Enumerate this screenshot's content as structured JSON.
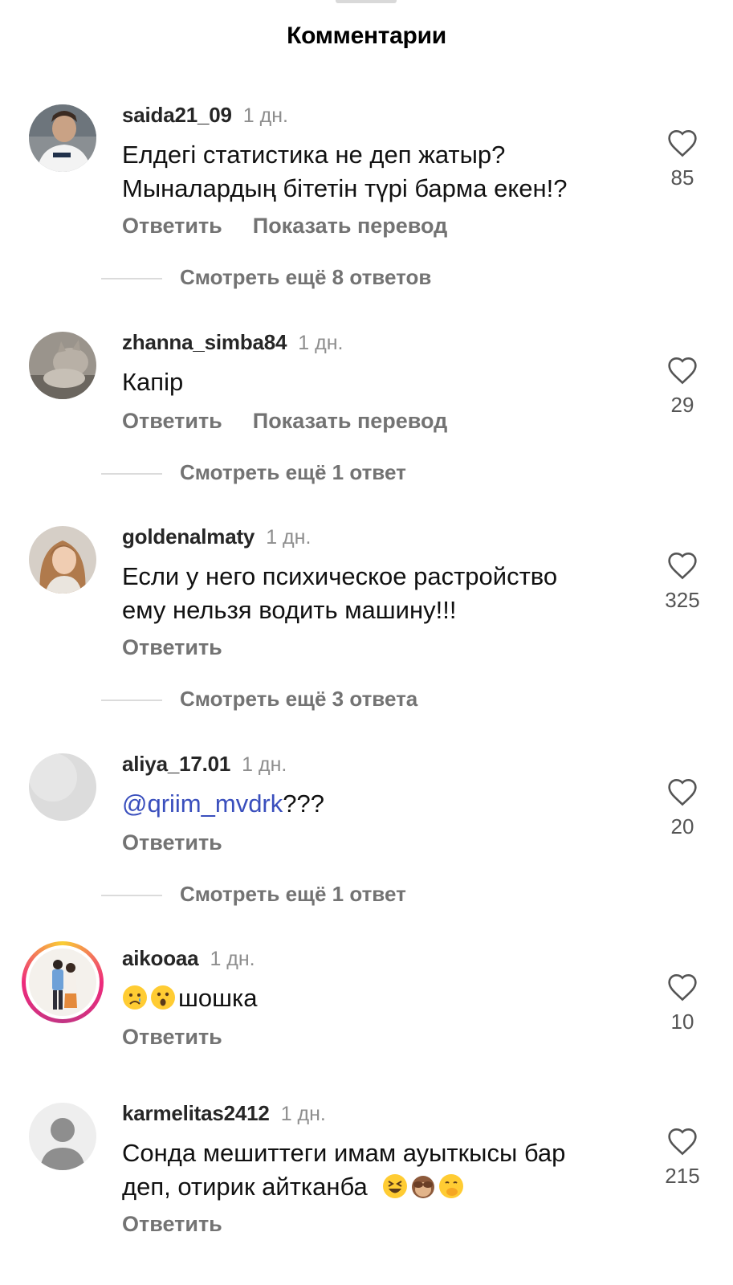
{
  "header": {
    "title": "Комментарии"
  },
  "comments": [
    {
      "username": "saida21_09",
      "time": "1 дн.",
      "text_lines": [
        "Елдегі статистика не деп жатыр?",
        "Мыналардың бітетін түрі барма екен!?"
      ],
      "reply_label": "Ответить",
      "translate_label": "Показать перевод",
      "likes": "85",
      "view_replies": "Смотреть ещё 8 ответов"
    },
    {
      "username": "zhanna_simba84",
      "time": "1 дн.",
      "text_lines": [
        "Капір"
      ],
      "reply_label": "Ответить",
      "translate_label": "Показать перевод",
      "likes": "29",
      "view_replies": "Смотреть ещё 1 ответ"
    },
    {
      "username": "goldenalmaty",
      "time": "1 дн.",
      "text_lines": [
        "Если у него психическое растройство",
        "ему нельзя водить машину!!!"
      ],
      "reply_label": "Ответить",
      "likes": "325",
      "view_replies": "Смотреть ещё 3 ответа"
    },
    {
      "username": "aliya_17.01",
      "time": "1 дн.",
      "mention": "@qriim_mvdrk",
      "text_after_mention": "???",
      "reply_label": "Ответить",
      "likes": "20",
      "view_replies": "Смотреть ещё 1 ответ"
    },
    {
      "username": "aikooaa",
      "time": "1 дн.",
      "text_emojis": [
        "crying-face",
        "astonished-face"
      ],
      "text": "шошка",
      "reply_label": "Ответить",
      "likes": "10"
    },
    {
      "username": "karmelitas2412",
      "time": "1 дн.",
      "text_lines": [
        "Сонда мешиттеги имам ауыткысы бар",
        "деп, отирик айтканба"
      ],
      "text_emojis": [
        "grinning-squinting-face",
        "see-no-evil-monkey",
        "face-with-hand-over-mouth"
      ],
      "reply_label": "Ответить",
      "likes": "215"
    }
  ],
  "colors": {
    "text": "#111111",
    "secondary": "#737373",
    "time": "#8e8e8e",
    "mention": "#3a4fbd",
    "divider": "#dbdbdb"
  }
}
